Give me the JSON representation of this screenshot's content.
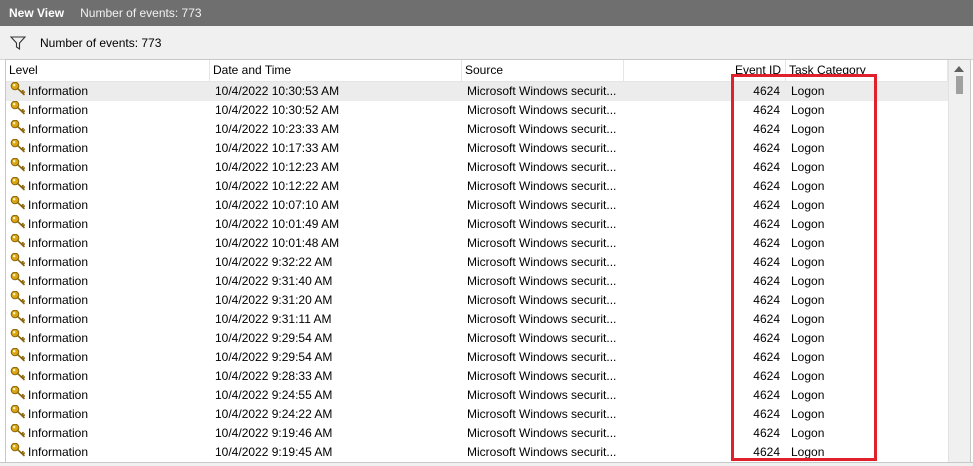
{
  "window": {
    "title": "New View",
    "event_count_label": "Number of events: 773"
  },
  "filter": {
    "text": "Number of events: 773",
    "icon": "filter-icon"
  },
  "columns": {
    "level": "Level",
    "date": "Date and Time",
    "source": "Source",
    "event_id": "Event ID",
    "task": "Task Category"
  },
  "colors": {
    "highlight": "#e0202a",
    "titlebar": "#6f6f6f"
  },
  "rows": [
    {
      "level": "Information",
      "date": "10/4/2022 10:30:53 AM",
      "source": "Microsoft Windows securit...",
      "event_id": "4624",
      "task": "Logon"
    },
    {
      "level": "Information",
      "date": "10/4/2022 10:30:52 AM",
      "source": "Microsoft Windows securit...",
      "event_id": "4624",
      "task": "Logon"
    },
    {
      "level": "Information",
      "date": "10/4/2022 10:23:33 AM",
      "source": "Microsoft Windows securit...",
      "event_id": "4624",
      "task": "Logon"
    },
    {
      "level": "Information",
      "date": "10/4/2022 10:17:33 AM",
      "source": "Microsoft Windows securit...",
      "event_id": "4624",
      "task": "Logon"
    },
    {
      "level": "Information",
      "date": "10/4/2022 10:12:23 AM",
      "source": "Microsoft Windows securit...",
      "event_id": "4624",
      "task": "Logon"
    },
    {
      "level": "Information",
      "date": "10/4/2022 10:12:22 AM",
      "source": "Microsoft Windows securit...",
      "event_id": "4624",
      "task": "Logon"
    },
    {
      "level": "Information",
      "date": "10/4/2022 10:07:10 AM",
      "source": "Microsoft Windows securit...",
      "event_id": "4624",
      "task": "Logon"
    },
    {
      "level": "Information",
      "date": "10/4/2022 10:01:49 AM",
      "source": "Microsoft Windows securit...",
      "event_id": "4624",
      "task": "Logon"
    },
    {
      "level": "Information",
      "date": "10/4/2022 10:01:48 AM",
      "source": "Microsoft Windows securit...",
      "event_id": "4624",
      "task": "Logon"
    },
    {
      "level": "Information",
      "date": "10/4/2022 9:32:22 AM",
      "source": "Microsoft Windows securit...",
      "event_id": "4624",
      "task": "Logon"
    },
    {
      "level": "Information",
      "date": "10/4/2022 9:31:40 AM",
      "source": "Microsoft Windows securit...",
      "event_id": "4624",
      "task": "Logon"
    },
    {
      "level": "Information",
      "date": "10/4/2022 9:31:20 AM",
      "source": "Microsoft Windows securit...",
      "event_id": "4624",
      "task": "Logon"
    },
    {
      "level": "Information",
      "date": "10/4/2022 9:31:11 AM",
      "source": "Microsoft Windows securit...",
      "event_id": "4624",
      "task": "Logon"
    },
    {
      "level": "Information",
      "date": "10/4/2022 9:29:54 AM",
      "source": "Microsoft Windows securit...",
      "event_id": "4624",
      "task": "Logon"
    },
    {
      "level": "Information",
      "date": "10/4/2022 9:29:54 AM",
      "source": "Microsoft Windows securit...",
      "event_id": "4624",
      "task": "Logon"
    },
    {
      "level": "Information",
      "date": "10/4/2022 9:28:33 AM",
      "source": "Microsoft Windows securit...",
      "event_id": "4624",
      "task": "Logon"
    },
    {
      "level": "Information",
      "date": "10/4/2022 9:24:55 AM",
      "source": "Microsoft Windows securit...",
      "event_id": "4624",
      "task": "Logon"
    },
    {
      "level": "Information",
      "date": "10/4/2022 9:24:22 AM",
      "source": "Microsoft Windows securit...",
      "event_id": "4624",
      "task": "Logon"
    },
    {
      "level": "Information",
      "date": "10/4/2022 9:19:46 AM",
      "source": "Microsoft Windows securit...",
      "event_id": "4624",
      "task": "Logon"
    },
    {
      "level": "Information",
      "date": "10/4/2022 9:19:45 AM",
      "source": "Microsoft Windows securit...",
      "event_id": "4624",
      "task": "Logon"
    }
  ]
}
